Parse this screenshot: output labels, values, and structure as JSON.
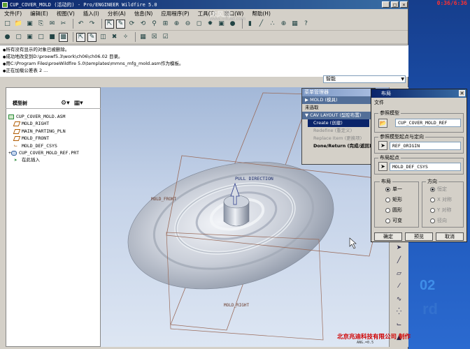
{
  "window": {
    "title": "CUP_COVER_MOLD (活动的) - Pro/ENGINEER Wildfire 5.0",
    "controls": [
      "_",
      "□",
      "×"
    ]
  },
  "desktop": {
    "clock": "0:36/6:36",
    "number": "02",
    "word": "rd"
  },
  "menubar": [
    "文件(F)",
    "编辑(E)",
    "视图(V)",
    "插入(I)",
    "分析(A)",
    "信息(N)",
    "应用程序(P)",
    "工具(T)",
    "窗口(W)",
    "帮助(H)"
  ],
  "messages": [
    "所有没有显示的对象已被删除。",
    "成功地改变到D:\\proewf5.3\\work\\ch06\\ch06.02 目录。",
    "用C:\\Program Files\\proeWildfire 5.0\\templates\\mmns_mfg_mold.asm作为模板。",
    "正在加载公差表 2 ..."
  ],
  "filter": "智能",
  "model_tree": {
    "header": "模型树",
    "items": [
      {
        "label": "CUP_COVER_MOLD.ASM",
        "level": 0,
        "icon": "assembly-icon"
      },
      {
        "label": "MOLD_RIGHT",
        "level": 1,
        "icon": "datum-plane-icon"
      },
      {
        "label": "MAIN_PARTING_PLN",
        "level": 1,
        "icon": "datum-plane-icon"
      },
      {
        "label": "MOLD_FRONT",
        "level": 1,
        "icon": "datum-plane-icon"
      },
      {
        "label": "MOLD_DEF_CSYS",
        "level": 1,
        "icon": "csys-icon"
      },
      {
        "label": "CUP_COVER_MOLD_REF.PRT",
        "level": 1,
        "icon": "part-icon"
      },
      {
        "label": "在此插入",
        "level": 1,
        "icon": "insert-arrow-icon"
      }
    ]
  },
  "graphics": {
    "labels": {
      "pull_direction": "PULL DIRECTION",
      "mold_front": "MOLD_FRONT",
      "mold_right": "MOLD_RIGHT"
    }
  },
  "menu_manager": {
    "title": "菜单管理器",
    "mold": "MOLD (模具)",
    "unselected": "未选取",
    "cav_layout": "CAV LAYOUT (型腔布置)",
    "items": [
      {
        "label": "Create (创建)",
        "state": "selected"
      },
      {
        "label": "Redefine (重定义)",
        "state": "disabled"
      },
      {
        "label": "Replace Item (更换项)",
        "state": "disabled"
      },
      {
        "label": "Done/Return (完成/返回)",
        "state": "bold"
      }
    ]
  },
  "layout_dialog": {
    "title": "布局",
    "menu_file": "文件",
    "ref_model_label": "参照模型",
    "ref_model_value": "CUP_COVER_MOLD_REF",
    "ref_origin_label": "参照模型起点与定向",
    "ref_origin_value": "REF_ORIGIN",
    "layout_origin_label": "布局起点",
    "layout_origin_value": "MOLD_DEF_CSYS",
    "layout_label": "布局",
    "layout_options": [
      "单一",
      "矩形",
      "圆形",
      "可变"
    ],
    "direction_label": "方向",
    "direction_options": [
      "恒定",
      "X 对称",
      "Y 对称",
      "径向"
    ],
    "buttons": {
      "ok": "确定",
      "preview": "预览",
      "cancel": "取消"
    }
  },
  "credit": "北京兆迪科技有限公司  制作",
  "watermark": {
    "site": "www.mfcad.com",
    "logo": "沐风网"
  },
  "status": "ANG.=0.5"
}
